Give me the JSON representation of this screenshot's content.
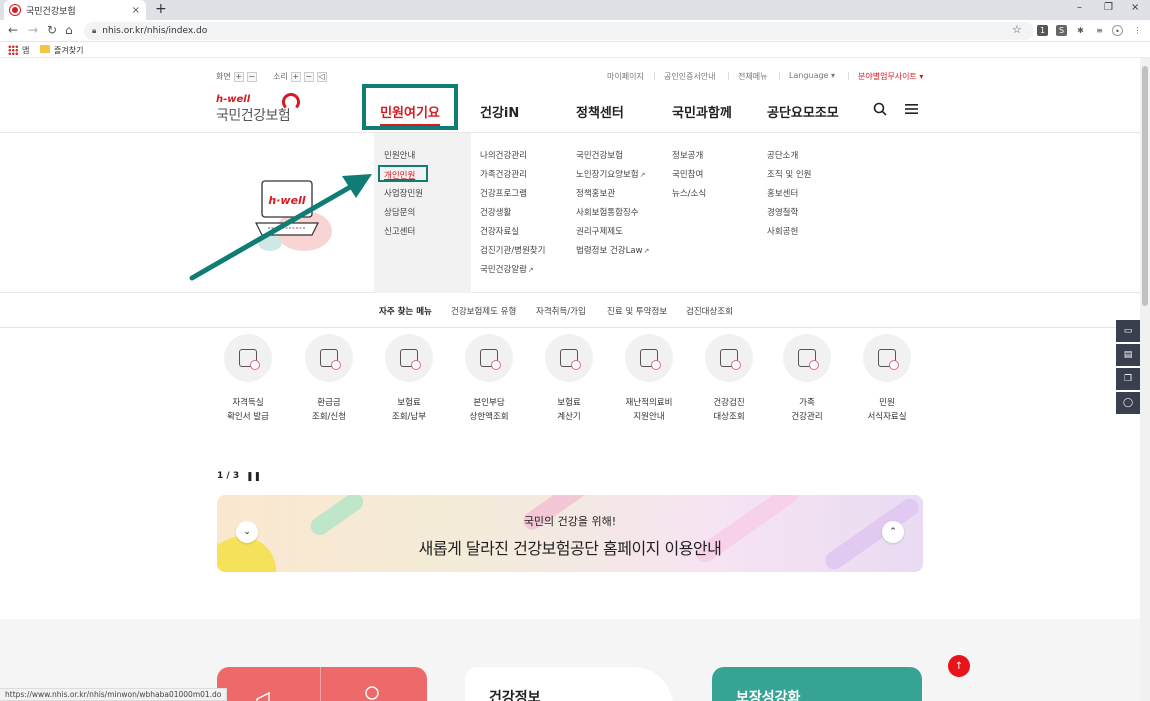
{
  "browser": {
    "tab_title": "국민건강보험",
    "new_tab": "+",
    "tab_close": "×",
    "window": {
      "minimize": "–",
      "restore": "❐",
      "close": "×"
    },
    "url": "nhis.or.kr/nhis/index.do",
    "bookmarks": {
      "apps_label": "앱",
      "folder_label": "즐겨찾기"
    },
    "status_url": "https://www.nhis.or.kr/nhis/minwon/wbhaba01000m01.do"
  },
  "utility": {
    "screen_label": "화면",
    "sound_label": "소리",
    "plus": "+",
    "minus": "−",
    "speaker": "◁",
    "links": [
      "마이페이지",
      "공인인증서안내",
      "전체메뉴"
    ],
    "language": "Language ▾",
    "family_site": "분야별업무사이트 ▾"
  },
  "logo": {
    "tagline": "h-well",
    "name": "국민건강보험"
  },
  "gnb": {
    "active": "민원여기요",
    "items": [
      "건강iN",
      "정책센터",
      "국민과함께",
      "공단요모조모"
    ],
    "search_icon": "search-icon",
    "menu_icon": "hamburger-menu-icon"
  },
  "mega_menu": {
    "col1": [
      "민원안내",
      "개인민원",
      "사업장민원",
      "상담문의",
      "신고센터"
    ],
    "col2": [
      "나의건강관리",
      "가족건강관리",
      "건강프로그램",
      "건강생활",
      "건강자료실",
      "검진기관/병원찾기",
      "국민건강알람"
    ],
    "col3": [
      "국민건강보험",
      "노인장기요양보험",
      "정책홍보관",
      "사회보험통합징수",
      "권리구제제도",
      "법령정보 건강Law"
    ],
    "col4": [
      "정보공개",
      "국민참여",
      "뉴스/소식"
    ],
    "col5": [
      "공단소개",
      "조직 및 인원",
      "홍보센터",
      "경영철학",
      "사회공헌"
    ],
    "external_icon": "↗"
  },
  "quick_nav": {
    "title": "자주 찾는 메뉴",
    "items": [
      "건강보험제도 유형",
      "자격취득/가입",
      "진료 및 투약정보",
      "검진대상조회"
    ]
  },
  "services": [
    {
      "l1": "자격득실",
      "l2": "확인서 발급",
      "icon": "certificate-icon"
    },
    {
      "l1": "환급금",
      "l2": "조회/신청",
      "icon": "refund-icon"
    },
    {
      "l1": "보험료",
      "l2": "조회/납부",
      "icon": "payment-icon"
    },
    {
      "l1": "본인부담",
      "l2": "상한액조회",
      "icon": "search-doc-icon"
    },
    {
      "l1": "보험료",
      "l2": "계산기",
      "icon": "calculator-icon"
    },
    {
      "l1": "재난적의료비",
      "l2": "지원안내",
      "icon": "medical-support-icon"
    },
    {
      "l1": "건강검진",
      "l2": "대상조회",
      "icon": "checkup-icon"
    },
    {
      "l1": "가족",
      "l2": "건강관리",
      "icon": "family-icon"
    },
    {
      "l1": "민원",
      "l2": "서식자료실",
      "icon": "form-icon"
    }
  ],
  "carousel": {
    "pager": "1 / 3",
    "pause": "❚❚",
    "prev": "⌄",
    "next": "⌃",
    "subtitle": "국민의 건강을 위해!",
    "title": "새롭게 달라진 건강보험공단 홈페이지 이용안내"
  },
  "cards": {
    "health_info": "건강정보",
    "teal": "보장성강화"
  },
  "top_button": "↑",
  "colors": {
    "brand_red": "#d71920",
    "highlight_teal": "#0f7d73",
    "teal_card": "#36a394",
    "red_card": "#ee6a6a"
  }
}
